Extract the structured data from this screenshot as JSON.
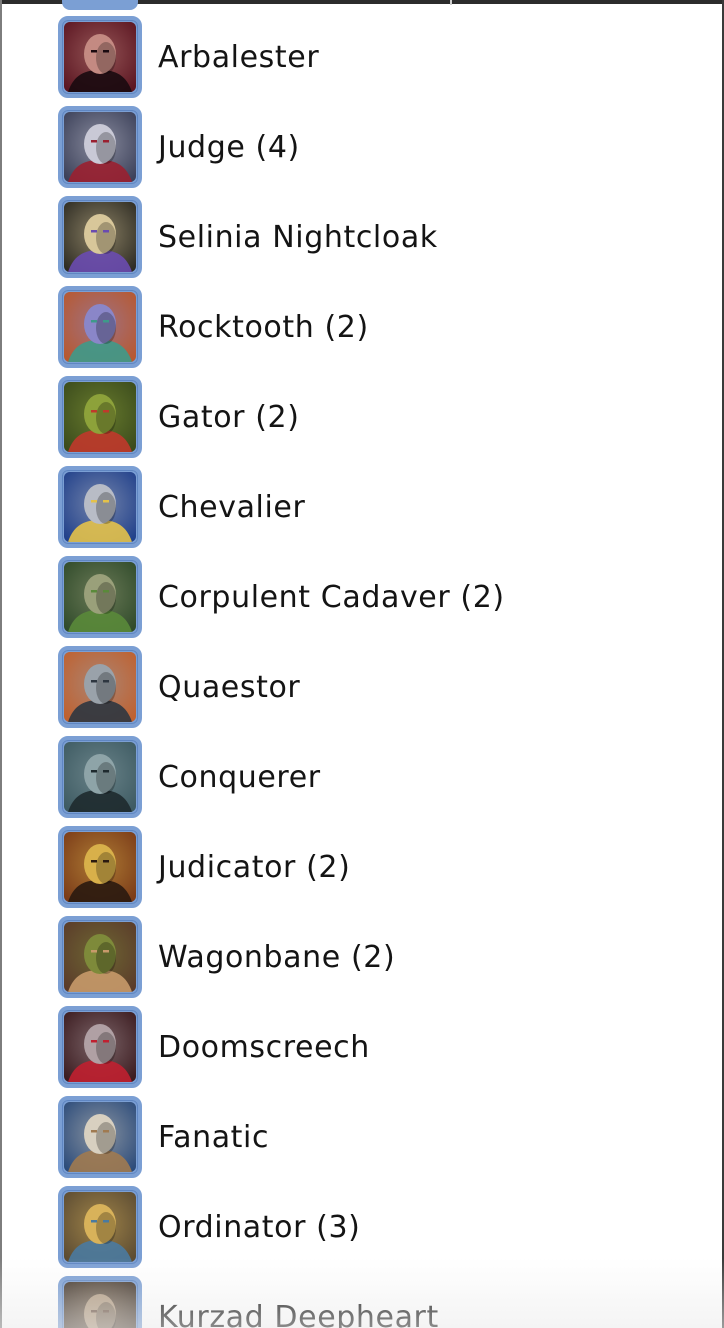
{
  "champions": [
    {
      "name": "Arbalester",
      "icon": "arbalester-portrait",
      "bg": "#5a1420",
      "fg": "#c48a82",
      "accent": "#1a0a10"
    },
    {
      "name": "Judge (4)",
      "icon": "judge-portrait",
      "bg": "#3a3f58",
      "fg": "#c9c9d6",
      "accent": "#9a2030"
    },
    {
      "name": "Selinia Nightcloak",
      "icon": "selinia-nightcloak-portrait",
      "bg": "#2c2a22",
      "fg": "#d8c79a",
      "accent": "#6a4bb0"
    },
    {
      "name": "Rocktooth (2)",
      "icon": "rocktooth-portrait",
      "bg": "#b8582e",
      "fg": "#8a86c8",
      "accent": "#3e9a8a"
    },
    {
      "name": "Gator (2)",
      "icon": "gator-portrait",
      "bg": "#3a4a1c",
      "fg": "#8da23a",
      "accent": "#c0392b"
    },
    {
      "name": "Chevalier",
      "icon": "chevalier-portrait",
      "bg": "#1f3f8a",
      "fg": "#b8bcc6",
      "accent": "#e4c24a"
    },
    {
      "name": "Corpulent Cadaver (2)",
      "icon": "corpulent-cadaver-portrait",
      "bg": "#2f4a2a",
      "fg": "#9aa07a",
      "accent": "#5a8a3a"
    },
    {
      "name": "Quaestor",
      "icon": "quaestor-portrait",
      "bg": "#c0602e",
      "fg": "#9aa2aa",
      "accent": "#2e3640"
    },
    {
      "name": "Conquerer",
      "icon": "conquerer-portrait",
      "bg": "#3d5a62",
      "fg": "#8ea4a8",
      "accent": "#1e2a2e"
    },
    {
      "name": "Judicator (2)",
      "icon": "judicator-portrait",
      "bg": "#7a3a18",
      "fg": "#d8b04a",
      "accent": "#2a1a10"
    },
    {
      "name": "Wagonbane (2)",
      "icon": "wagonbane-portrait",
      "bg": "#5a3a2a",
      "fg": "#7e8a3a",
      "accent": "#c89a6a"
    },
    {
      "name": "Doomscreech",
      "icon": "doomscreech-portrait",
      "bg": "#3a1a1e",
      "fg": "#b0a0a4",
      "accent": "#c02030"
    },
    {
      "name": "Fanatic",
      "icon": "fanatic-portrait",
      "bg": "#2a4a7a",
      "fg": "#d8d0c0",
      "accent": "#a07a50"
    },
    {
      "name": "Ordinator (3)",
      "icon": "ordinator-portrait",
      "bg": "#5a4a32",
      "fg": "#d8b25a",
      "accent": "#4a7aa0"
    },
    {
      "name": "Kurzad Deepheart",
      "icon": "kurzad-deepheart-portrait",
      "bg": "#3a2e24",
      "fg": "#b09a80",
      "accent": "#6a5040"
    }
  ]
}
